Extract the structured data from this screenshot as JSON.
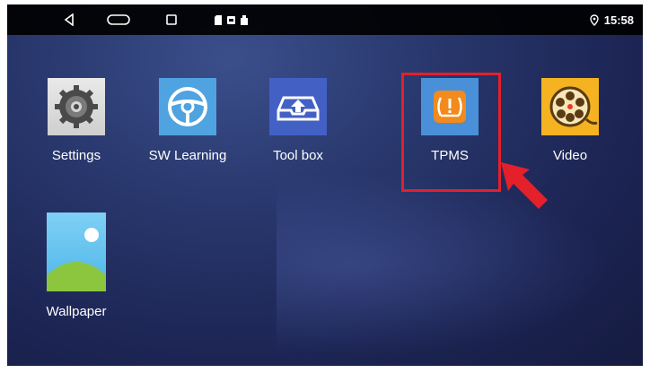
{
  "status_bar": {
    "time": "15:58",
    "icons": [
      "back-triangle-icon",
      "home-pill-icon",
      "recents-square-icon",
      "sim-icon",
      "sd-card-icon",
      "usb-icon",
      "location-pin-icon"
    ]
  },
  "apps": [
    {
      "label": "Settings",
      "icon": "gear-icon"
    },
    {
      "label": "SW Learning",
      "icon": "steering-wheel-icon"
    },
    {
      "label": "Tool box",
      "icon": "tray-upload-icon"
    },
    {
      "label": "TPMS",
      "icon": "tire-pressure-warning-icon"
    },
    {
      "label": "Video",
      "icon": "film-reel-icon"
    },
    {
      "label": "Wallpaper",
      "icon": "landscape-icon"
    }
  ],
  "colors": {
    "highlight": "#e4202a",
    "arrow": "#e4202a",
    "tpms_tile": "#4a90d9",
    "tpms_badge": "#f28a1c"
  }
}
